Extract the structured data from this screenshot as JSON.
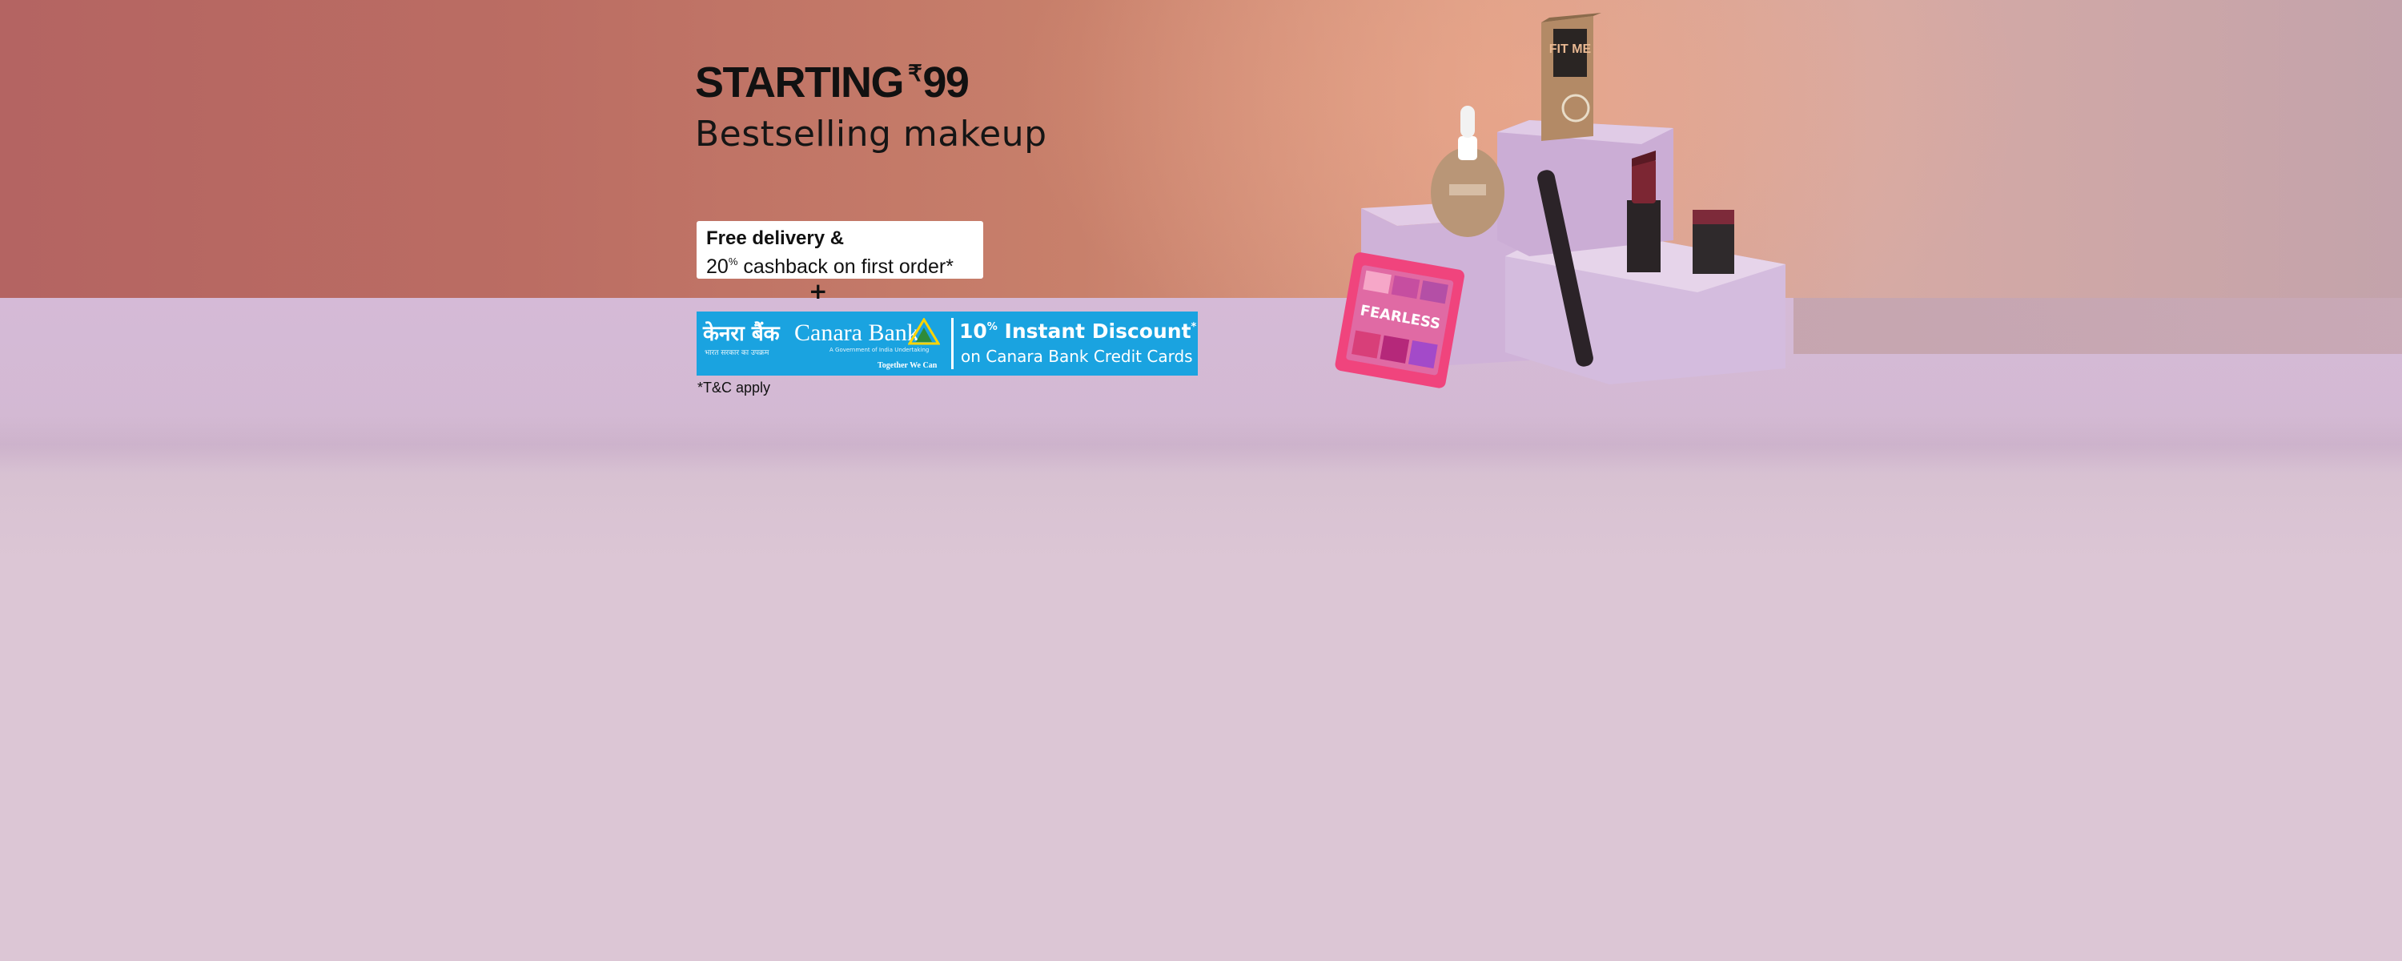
{
  "hero": {
    "headline_prefix": "STARTING",
    "headline_currency": "₹",
    "headline_price": "99",
    "subheadline": "Bestselling makeup"
  },
  "offer": {
    "line1": "Free delivery &",
    "line2_number": "20",
    "line2_percent": "%",
    "line2_text": " cashback on first order*"
  },
  "separator": "+",
  "bank_offer": {
    "bank_name_hindi": "केनरा बैंक",
    "hindi_subline": "भारत सरकार का उपक्रम",
    "bank_name": "Canara Bank",
    "govt_line": "A Government of India Undertaking",
    "tagline": "Together We Can",
    "discount_number": "10",
    "discount_percent": "%",
    "discount_text": " Instant Discount",
    "discount_mark": "*",
    "discount_subline": "on Canara Bank Credit Cards",
    "brand_color": "#1aa3e0"
  },
  "disclaimer": "*T&C apply",
  "products": {
    "box_text": "FIT ME",
    "palette_text": "FEARLESS"
  }
}
